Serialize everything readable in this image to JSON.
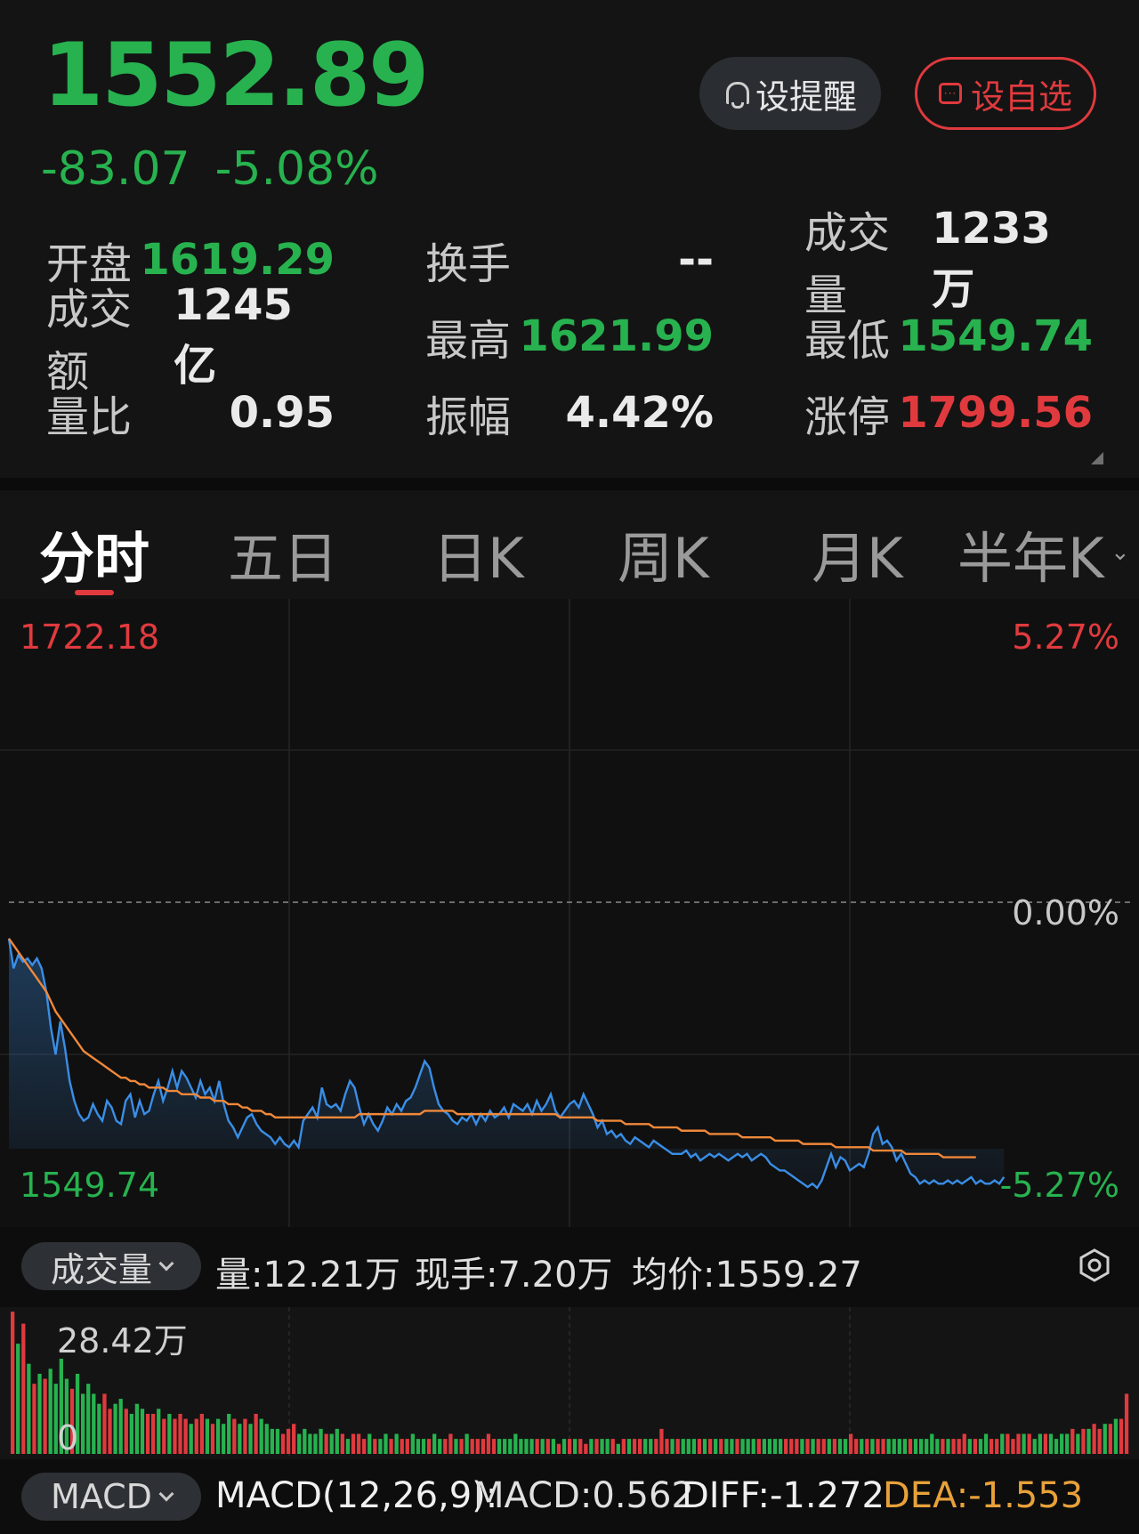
{
  "quote": {
    "price": "1552.89",
    "change": "-83.07",
    "change_pct": "-5.08%"
  },
  "buttons": {
    "alert_label": "设提醒",
    "fav_label": "设自选"
  },
  "stats": [
    {
      "label": "开盘",
      "value": "1619.29",
      "color": "#27b24f"
    },
    {
      "label": "换手",
      "value": "--",
      "color": "#eaeaea"
    },
    {
      "label": "成交量",
      "value": "1233万",
      "color": "#eaeaea"
    },
    {
      "label": "成交额",
      "value": "1245亿",
      "color": "#eaeaea"
    },
    {
      "label": "最高",
      "value": "1621.99",
      "color": "#27b24f"
    },
    {
      "label": "最低",
      "value": "1549.74",
      "color": "#27b24f"
    },
    {
      "label": "量比",
      "value": "0.95",
      "color": "#eaeaea"
    },
    {
      "label": "振幅",
      "value": "4.42%",
      "color": "#eaeaea"
    },
    {
      "label": "涨停",
      "value": "1799.56",
      "color": "#e03a3e"
    }
  ],
  "tabs": [
    "分时",
    "五日",
    "日K",
    "周K",
    "月K",
    "半年K"
  ],
  "active_tab": "分时",
  "chart_axis": {
    "top_price": "1722.18",
    "top_pct": "5.27%",
    "mid_pct": "0.00%",
    "bottom_price": "1549.74",
    "bottom_pct": "-5.27%"
  },
  "volume_panel": {
    "selector": "成交量",
    "volume": "量:12.21万",
    "current_hand": "现手:7.20万",
    "avg_price": "均价:1559.27",
    "max_label": "28.42万",
    "zero_label": "0"
  },
  "macd_panel": {
    "selector": "MACD",
    "params": "MACD(12,26,9):",
    "macd": "MACD:0.562",
    "diff": "DIFF:-1.272",
    "dea": "DEA:-1.553"
  },
  "colors": {
    "up": "#e03a3e",
    "down": "#27b24f",
    "price_line": "#3a8ee6",
    "avg_line": "#f0883a",
    "dea": "#e8a13a"
  },
  "chart_data": {
    "type": "line",
    "title": "",
    "ylim": [
      1549.74,
      1722.18
    ],
    "prev_close": 1635.96,
    "series": [
      {
        "values": [
          1625,
          1616,
          1620,
          1618,
          1619,
          1617,
          1619,
          1616,
          1609,
          1598,
          1590,
          1600,
          1592,
          1582,
          1576,
          1572,
          1570,
          1571,
          1575,
          1572,
          1570,
          1576,
          1574,
          1570,
          1569,
          1576,
          1578,
          1571,
          1576,
          1572,
          1573,
          1578,
          1582,
          1576,
          1580,
          1585,
          1580,
          1585,
          1583,
          1580,
          1577,
          1582,
          1578,
          1580,
          1576,
          1582,
          1575,
          1570,
          1568,
          1565,
          1568,
          1571,
          1572,
          1569,
          1567,
          1566,
          1565,
          1563,
          1565,
          1563,
          1562,
          1564,
          1562,
          1570,
          1572,
          1574,
          1571,
          1580,
          1575,
          1574,
          1575,
          1573,
          1578,
          1582,
          1580,
          1574,
          1569,
          1572,
          1569,
          1567,
          1570,
          1574,
          1572,
          1575,
          1573,
          1576,
          1577,
          1580,
          1584,
          1588,
          1586,
          1580,
          1575,
          1573,
          1572,
          1570,
          1569,
          1571,
          1570,
          1572,
          1569,
          1572,
          1570,
          1573,
          1571,
          1572,
          1574,
          1571,
          1575,
          1574,
          1573,
          1575,
          1572,
          1576,
          1573,
          1575,
          1578,
          1573,
          1571,
          1573,
          1575,
          1576,
          1574,
          1578,
          1575,
          1572,
          1568,
          1570,
          1566,
          1567,
          1565,
          1566,
          1564,
          1563,
          1565,
          1564,
          1563,
          1562,
          1564,
          1563,
          1562,
          1561,
          1560,
          1560,
          1560,
          1561,
          1559,
          1560,
          1558,
          1559,
          1560,
          1559,
          1560,
          1559,
          1558,
          1559,
          1560,
          1559,
          1560,
          1558,
          1559,
          1560,
          1559,
          1557,
          1556,
          1555,
          1555,
          1554,
          1553,
          1552,
          1551,
          1550,
          1551,
          1549.74,
          1552,
          1556,
          1560,
          1556,
          1559,
          1558,
          1555,
          1556,
          1557,
          1556,
          1560,
          1566,
          1568,
          1563,
          1564,
          1562,
          1558,
          1560,
          1557,
          1554,
          1553,
          1551,
          1552,
          1551,
          1552,
          1551,
          1551,
          1552,
          1551,
          1552,
          1551,
          1552,
          1553,
          1551,
          1552,
          1551,
          1551,
          1552,
          1551,
          1553
        ],
        "name": ""
      },
      {
        "values": [
          1625,
          1623,
          1621,
          1619,
          1617,
          1615,
          1613,
          1611,
          1609,
          1606,
          1603,
          1601,
          1599,
          1597,
          1595,
          1593,
          1591,
          1590,
          1589,
          1588,
          1587,
          1586,
          1585,
          1584,
          1583,
          1583,
          1582,
          1582,
          1581,
          1581,
          1580,
          1580,
          1580,
          1580,
          1579,
          1579,
          1579,
          1578,
          1578,
          1578,
          1578,
          1577,
          1577,
          1577,
          1576,
          1576,
          1576,
          1575,
          1575,
          1575,
          1574,
          1574,
          1573,
          1573,
          1573,
          1572,
          1572,
          1571,
          1571,
          1571,
          1571,
          1571,
          1571,
          1571,
          1571,
          1571,
          1571,
          1571,
          1571,
          1571,
          1571,
          1571,
          1571,
          1571,
          1571,
          1572,
          1572,
          1572,
          1572,
          1572,
          1572,
          1572,
          1572,
          1572,
          1572,
          1572,
          1572,
          1572,
          1572,
          1573,
          1573,
          1573,
          1573,
          1573,
          1573,
          1573,
          1572,
          1572,
          1572,
          1572,
          1572,
          1572,
          1572,
          1572,
          1572,
          1572,
          1572,
          1572,
          1572,
          1572,
          1572,
          1572,
          1572,
          1572,
          1572,
          1572,
          1572,
          1572,
          1571,
          1571,
          1571,
          1571,
          1571,
          1571,
          1571,
          1571,
          1570,
          1570,
          1570,
          1570,
          1570,
          1570,
          1569,
          1569,
          1569,
          1569,
          1569,
          1569,
          1568,
          1568,
          1568,
          1568,
          1568,
          1568,
          1567,
          1567,
          1567,
          1567,
          1567,
          1567,
          1566,
          1566,
          1566,
          1566,
          1566,
          1566,
          1566,
          1565,
          1565,
          1565,
          1565,
          1565,
          1565,
          1565,
          1564,
          1564,
          1564,
          1564,
          1564,
          1564,
          1563,
          1563,
          1563,
          1563,
          1563,
          1563,
          1563,
          1562,
          1562,
          1562,
          1562,
          1562,
          1562,
          1562,
          1562,
          1561,
          1561,
          1561,
          1561,
          1561,
          1561,
          1561,
          1560,
          1560,
          1560,
          1560,
          1560,
          1560,
          1560,
          1560,
          1559,
          1559,
          1559,
          1559,
          1559,
          1559,
          1559,
          1559
        ],
        "name": ""
      }
    ],
    "volume": {
      "ylim": [
        0,
        28.42
      ],
      "values": [
        28.4,
        22,
        26,
        18,
        14,
        16,
        15,
        17,
        14,
        19,
        15,
        13,
        16,
        12,
        14,
        12,
        10,
        12,
        9,
        10,
        11,
        9,
        8,
        10,
        9,
        8,
        8,
        9,
        7,
        8,
        7,
        8,
        7,
        6,
        7,
        8,
        7,
        6,
        7,
        6,
        8,
        7,
        6,
        7,
        6,
        8,
        7,
        6,
        5,
        5,
        4,
        5,
        6,
        4,
        5,
        4,
        4,
        5,
        4,
        4,
        5,
        4,
        3,
        4,
        4,
        3,
        4,
        3,
        3,
        4,
        3,
        4,
        3,
        3,
        4,
        3,
        3,
        3,
        4,
        3,
        3,
        4,
        3,
        3,
        4,
        3,
        3,
        3,
        4,
        3,
        3,
        3,
        3,
        4,
        3,
        3,
        3,
        3,
        3,
        3,
        3,
        2,
        3,
        3,
        3,
        3,
        2,
        3,
        3,
        3,
        3,
        3,
        2,
        3,
        3,
        3,
        3,
        3,
        3,
        3,
        5,
        3,
        3,
        3,
        3,
        3,
        3,
        3,
        3,
        3,
        3,
        3,
        3,
        3,
        3,
        3,
        3,
        3,
        3,
        3,
        3,
        3,
        3,
        3,
        3,
        3,
        3,
        3,
        3,
        3,
        3,
        3,
        3,
        3,
        3,
        4,
        3,
        3,
        3,
        3,
        3,
        3,
        3,
        3,
        3,
        3,
        3,
        3,
        3,
        3,
        4,
        3,
        3,
        3,
        3,
        3,
        4,
        3,
        3,
        3,
        4,
        3,
        3,
        4,
        4,
        3,
        4,
        4,
        4,
        3,
        4,
        4,
        4,
        3,
        4,
        4,
        5,
        4,
        5,
        5,
        6,
        5,
        6,
        6,
        7,
        7,
        12
      ]
    }
  }
}
